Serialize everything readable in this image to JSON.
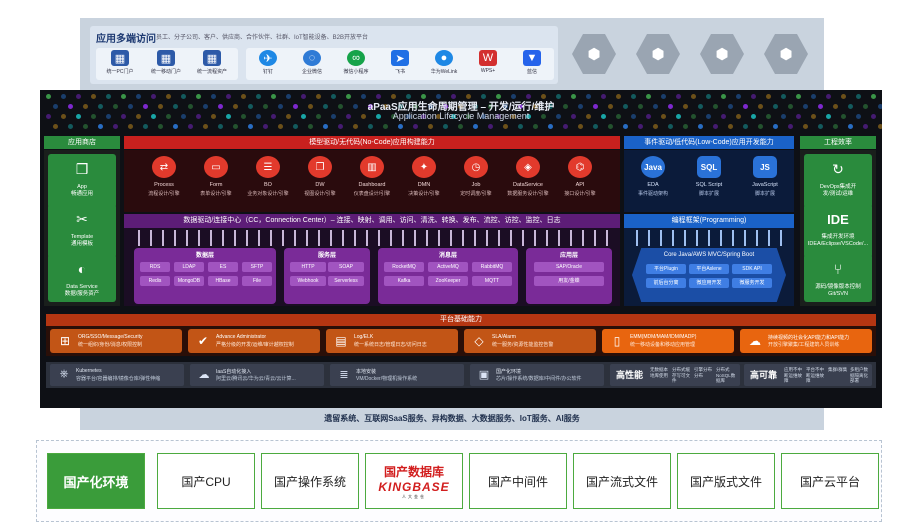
{
  "access": {
    "title": "应用多端访问",
    "subtitle": "员工、分子公司、客户、供应商、合作伙伴、社群、IoT智能设备、B2B开放平台",
    "portals": [
      {
        "label": "统一PC门户",
        "icon": "grid-icon"
      },
      {
        "label": "统一移动门户",
        "icon": "grid-icon"
      },
      {
        "label": "统一流程资产",
        "icon": "grid-icon"
      }
    ],
    "channels": [
      {
        "label": "钉钉",
        "icon": "dingtalk-icon",
        "color": "#1e88e5"
      },
      {
        "label": "企业微信",
        "icon": "wecom-icon",
        "color": "#2f7bd6"
      },
      {
        "label": "微信小程序",
        "icon": "miniprogram-icon",
        "color": "#16a34a"
      },
      {
        "label": "飞书",
        "icon": "feishu-icon",
        "color": "#1f6fe5"
      },
      {
        "label": "华为WeLink",
        "icon": "welink-icon",
        "color": "#1e88e5"
      },
      {
        "label": "WPS+",
        "icon": "wps-icon",
        "color": "#d32f2f"
      },
      {
        "label": "蓝信",
        "icon": "lanxin-icon",
        "color": "#2563eb"
      }
    ],
    "hex_icons": [
      "network-icon",
      "network-icon",
      "network-icon",
      "network-icon"
    ]
  },
  "lifecycle": {
    "title_cn": "aPaaS应用生命周期管理 – 开发/运行/维护",
    "title_en": "Application Lifecycle Management"
  },
  "left_column": {
    "title": "应用商店",
    "cards": [
      {
        "line1": "App",
        "line2": "畅通应用",
        "icon": "cube-icon"
      },
      {
        "line1": "Template",
        "line2": "通用模板",
        "icon": "template-icon"
      },
      {
        "line1": "Data Service",
        "line2": "数据/服务资产",
        "icon": "toggle-icon"
      }
    ]
  },
  "right_column": {
    "title": "工程效率",
    "cards": [
      {
        "line1": "DevOps集成开",
        "line2": "发/测试/运维",
        "icon": "devops-icon"
      },
      {
        "line1": "集成开发环境",
        "line2": "IDEA/Eclipse/VSCode/...",
        "icon": "ide-icon",
        "icon_text": "IDE"
      },
      {
        "line1": "源码/镜像版本控制",
        "line2": "Git/SVN",
        "icon": "git-icon"
      }
    ]
  },
  "model_driven": {
    "title": "模型驱动/无代码(No-Code)应用构建能力",
    "modules": [
      {
        "name": "Process",
        "desc": "流程设计/引擎",
        "icon": "process-icon"
      },
      {
        "name": "Form",
        "desc": "表单设计/引擎",
        "icon": "form-icon"
      },
      {
        "name": "BO",
        "desc": "业务对象设计/引擎",
        "icon": "database-icon"
      },
      {
        "name": "DW",
        "desc": "视图设计/引擎",
        "icon": "view-icon"
      },
      {
        "name": "Dashboard",
        "desc": "仪表盘设计/引擎",
        "icon": "chart-icon"
      },
      {
        "name": "DMN",
        "desc": "决策设计/引擎",
        "icon": "decision-icon"
      },
      {
        "name": "Job",
        "desc": "定时调度/引擎",
        "icon": "clock-icon"
      },
      {
        "name": "DataService",
        "desc": "数据服务设计/引擎",
        "icon": "dataservice-icon"
      },
      {
        "name": "API",
        "desc": "接口设计/引擎",
        "icon": "api-icon"
      }
    ]
  },
  "event_driven": {
    "title": "事件驱动/低代码(Low-Code)应用开发能力",
    "modules": [
      {
        "name": "EDA",
        "desc": "事件驱动架构",
        "icon_text": "Java"
      },
      {
        "name": "SQL Script",
        "desc": "脚本扩展",
        "icon_text": "SQL"
      },
      {
        "name": "JavaScript",
        "desc": "脚本扩展",
        "icon_text": "JS"
      }
    ]
  },
  "connection": {
    "title": "数据驱动/连接中心（CC，Connection Center）– 连接、映射、调用、访问、清洗、转换、发布、流控、访控、监控、日志",
    "groups": [
      {
        "title": "数据层",
        "chips": [
          "RDS",
          "LDAP",
          "ES",
          "SFTP",
          "Redis",
          "MongoDB",
          "HBase",
          "File"
        ]
      },
      {
        "title": "服务层",
        "chips": [
          "HTTP",
          "SOAP",
          "Webhook",
          "Serverless"
        ]
      },
      {
        "title": "消息层",
        "chips": [
          "RocketMQ",
          "ActiveMQ",
          "RabbitMQ",
          "Kafka",
          "ZooKeeper",
          "MQTT"
        ]
      },
      {
        "title": "应用层",
        "chips": [
          "SAP/Oracle",
          "用友/金蝶"
        ]
      }
    ]
  },
  "programming": {
    "title": "编程框架(Programming)",
    "subtitle": "Core Java/AWS MVC/Spring Boot",
    "chips": [
      "平台Plugin",
      "平台Aslene",
      "SDK API",
      "前后台分离",
      "微应用开发",
      "微服务开发"
    ]
  },
  "platform": {
    "title": "平台基础能力",
    "items": [
      {
        "line1": "ORG/SSO/Message/Security",
        "line2": "统一组织/身份/消息/权限控制",
        "icon": "org-icon"
      },
      {
        "line1": "Advance Administrator",
        "line2": "严格分级的开发/运维/审计越权控制",
        "icon": "shield-check-icon"
      },
      {
        "line1": "Log/ELK",
        "line2": "统一系统日志/管理日志/访问日志",
        "icon": "log-icon"
      },
      {
        "line1": "SLA/Alarm",
        "line2": "统一服务/资源性能监控告警",
        "icon": "diamond-icon"
      },
      {
        "line1": "EMM(MDM/MAM/IDM/MADP)",
        "line2": "统一移动设备和移动应用管理",
        "icon": "mobile-icon"
      },
      {
        "line1": "持续视频的社会化API能力和API能力",
        "line2": "开放引擎聚集/工程建筑人员训练",
        "icon": "api-cloud-icon"
      }
    ]
  },
  "infra": {
    "items": [
      {
        "line1": "Kubernetes",
        "line2": "容器平台/容器编排/镜像仓库/弹性伸缩",
        "icon": "kubernetes-icon"
      },
      {
        "line1": "IaaS自动化接入",
        "line2": "阿里云/腾讯云/华为云/青云/云计算...",
        "icon": "cloud-icon"
      },
      {
        "line1": "本地安装",
        "line2": "VM/Docker/物理机操作系统",
        "icon": "server-icon"
      },
      {
        "line1": "国产化环境",
        "line2": "芯片/操作系统/数据库/中间件/办公软件",
        "icon": "chip-icon"
      }
    ],
    "ha": {
      "title": "高性能",
      "subs": [
        "无数据本地库使用",
        "分布式缓存写可文件",
        "引擎分布分布",
        "分布式NoSQL数据库"
      ]
    },
    "rel": {
      "title": "高可靠",
      "subs": [
        "应用不中断运维故障",
        "平台不中断运维故障",
        "集群/群集",
        "多租户数据隔离化部署"
      ]
    }
  },
  "bottom_line": "遗留系统、互联网SaaS服务、异构数据、大数据服务、IoT服务、AI服务",
  "localization": {
    "primary": "国产化环境",
    "items": [
      "国产CPU",
      "国产操作系统",
      "国产中间件",
      "国产流式文件",
      "国产版式文件",
      "国产云平台"
    ],
    "kingbase": {
      "cn": "国产数据库",
      "en": "KINGBASE",
      "sub": "人大金仓"
    }
  }
}
